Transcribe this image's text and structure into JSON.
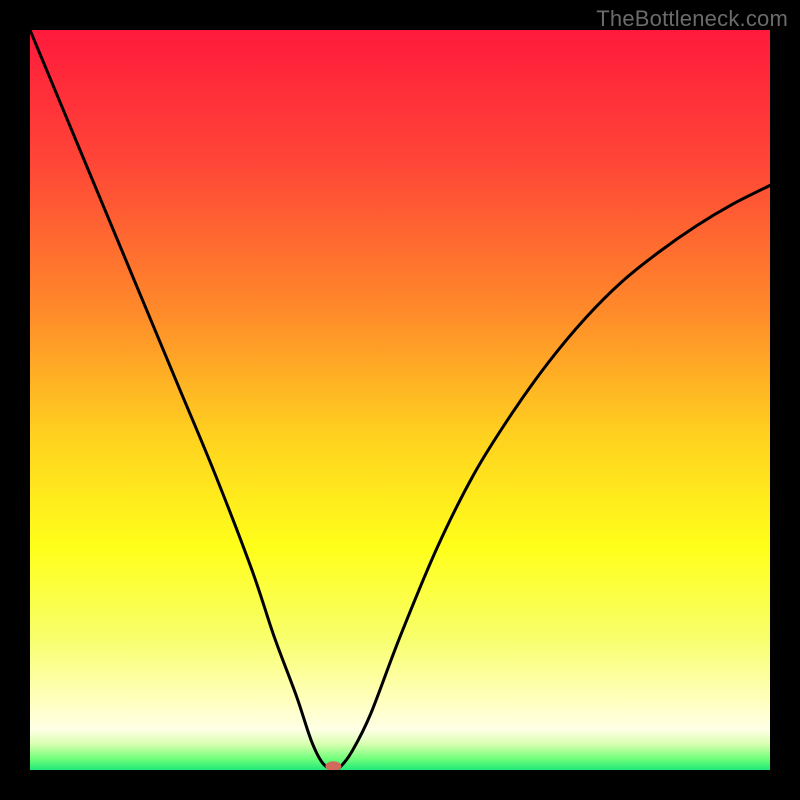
{
  "watermark": "TheBottleneck.com",
  "chart_data": {
    "type": "line",
    "title": "",
    "xlabel": "",
    "ylabel": "",
    "xlim": [
      0,
      100
    ],
    "ylim": [
      0,
      100
    ],
    "grid": false,
    "legend": false,
    "background_gradient": {
      "stops": [
        {
          "pos": 0.0,
          "color": "#ff1a3c"
        },
        {
          "pos": 0.18,
          "color": "#ff4637"
        },
        {
          "pos": 0.38,
          "color": "#ff8a2a"
        },
        {
          "pos": 0.55,
          "color": "#ffd21f"
        },
        {
          "pos": 0.7,
          "color": "#ffff1a"
        },
        {
          "pos": 0.82,
          "color": "#f8ff6a"
        },
        {
          "pos": 0.9,
          "color": "#ffffb8"
        },
        {
          "pos": 0.945,
          "color": "#ffffe6"
        },
        {
          "pos": 0.965,
          "color": "#d8ffb0"
        },
        {
          "pos": 0.985,
          "color": "#6fff7a"
        },
        {
          "pos": 1.0,
          "color": "#20e87a"
        }
      ]
    },
    "series": [
      {
        "name": "bottleneck-curve",
        "type": "line",
        "x": [
          0,
          5,
          10,
          15,
          20,
          25,
          30,
          33,
          36,
          38,
          39.5,
          41,
          42,
          43.5,
          46,
          50,
          55,
          60,
          65,
          70,
          75,
          80,
          85,
          90,
          95,
          100
        ],
        "y": [
          100,
          88,
          76,
          64,
          52,
          40,
          27,
          18,
          10,
          4,
          1,
          0,
          0.5,
          2.5,
          7.5,
          18,
          30,
          40,
          48,
          55,
          61,
          66,
          70,
          73.5,
          76.5,
          79
        ]
      }
    ],
    "marker": {
      "name": "bottleneck-minimum",
      "x": 41,
      "y": 0.5,
      "color": "#d06a5a",
      "rx": 8,
      "ry": 5
    }
  }
}
